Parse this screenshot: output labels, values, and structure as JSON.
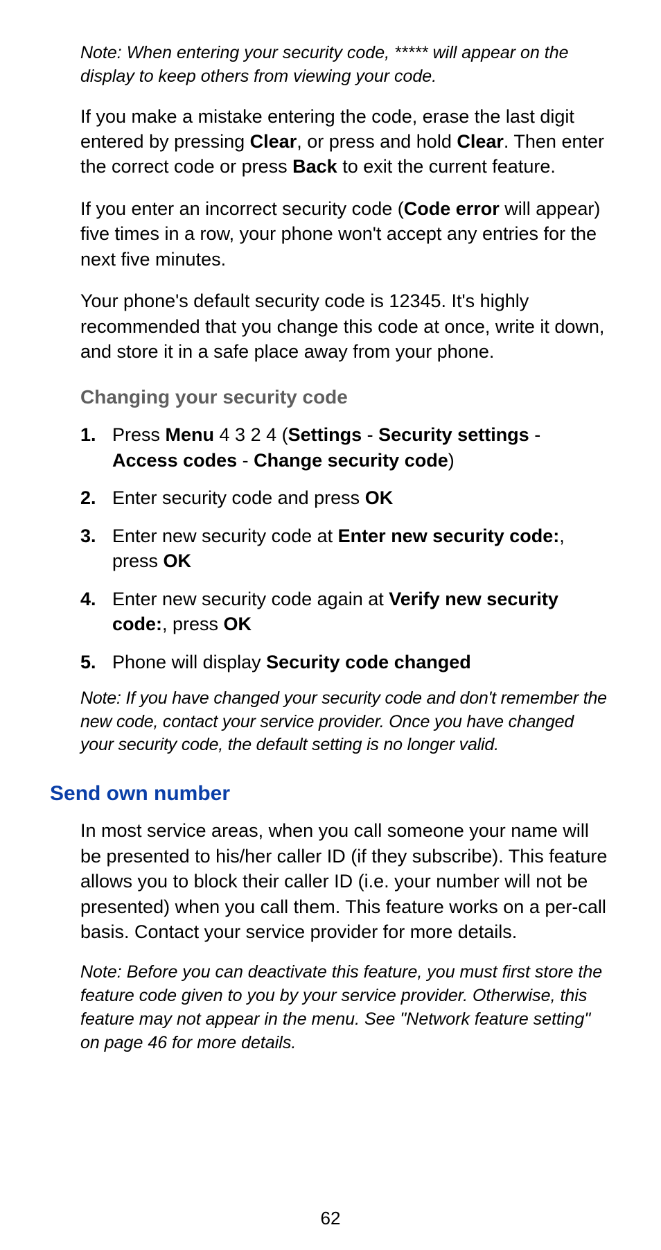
{
  "note1": "Note: When entering your security code, ***** will appear on the display to keep others from viewing your code.",
  "para1": {
    "t1": "If you make a mistake entering the code, erase the last digit entered by pressing ",
    "b1": "Clear",
    "t2": ", or press and hold ",
    "b2": "Clear",
    "t3": ". Then enter the correct code or press ",
    "b3": "Back",
    "t4": " to exit the current feature."
  },
  "para2": {
    "t1": "If you enter an incorrect security code (",
    "b1": "Code error",
    "t2": " will appear) five times in a row, your phone won't accept any entries for the next five minutes."
  },
  "para3": "Your phone's default security code is 12345. It's highly recommended that you change this code at once, write it down, and store it in a safe place away from your phone.",
  "h2_1": "Changing your security code",
  "steps": {
    "n1": "1.",
    "s1": {
      "t1": "Press ",
      "b1": "Menu",
      "t2": " 4 3 2 4 (",
      "b2": "Settings",
      "t3": " - ",
      "b3": "Security settings",
      "t4": " - ",
      "b4": "Access codes",
      "t5": " - ",
      "b5": "Change security code",
      "t6": ")"
    },
    "n2": "2.",
    "s2": {
      "t1": "Enter security code and press ",
      "b1": "OK"
    },
    "n3": "3.",
    "s3": {
      "t1": "Enter new security code at ",
      "b1": "Enter new security code:",
      "t2": ", press ",
      "b2": "OK"
    },
    "n4": "4.",
    "s4": {
      "t1": "Enter new security code again at ",
      "b1": "Verify new security code:",
      "t2": ", press ",
      "b2": "OK"
    },
    "n5": "5.",
    "s5": {
      "t1": "Phone will display ",
      "b1": "Security code changed"
    }
  },
  "note2": "Note: If you have changed your security code and don't remember the new code, contact your service provider. Once you have changed your security code, the default setting is no longer valid.",
  "h1_1": "Send own number",
  "para4": "In most service areas, when you call someone your name will be presented to his/her caller ID (if they subscribe). This feature allows you to block their caller ID (i.e. your number will not be presented) when you call them. This feature works on a per-call basis. Contact your service provider for more details.",
  "note3": "Note: Before you can deactivate this feature, you must first store the feature code given to you by your service provider. Otherwise, this feature may not appear in the menu. See \"Network feature setting\" on page 46 for more details.",
  "pageNum": "62"
}
